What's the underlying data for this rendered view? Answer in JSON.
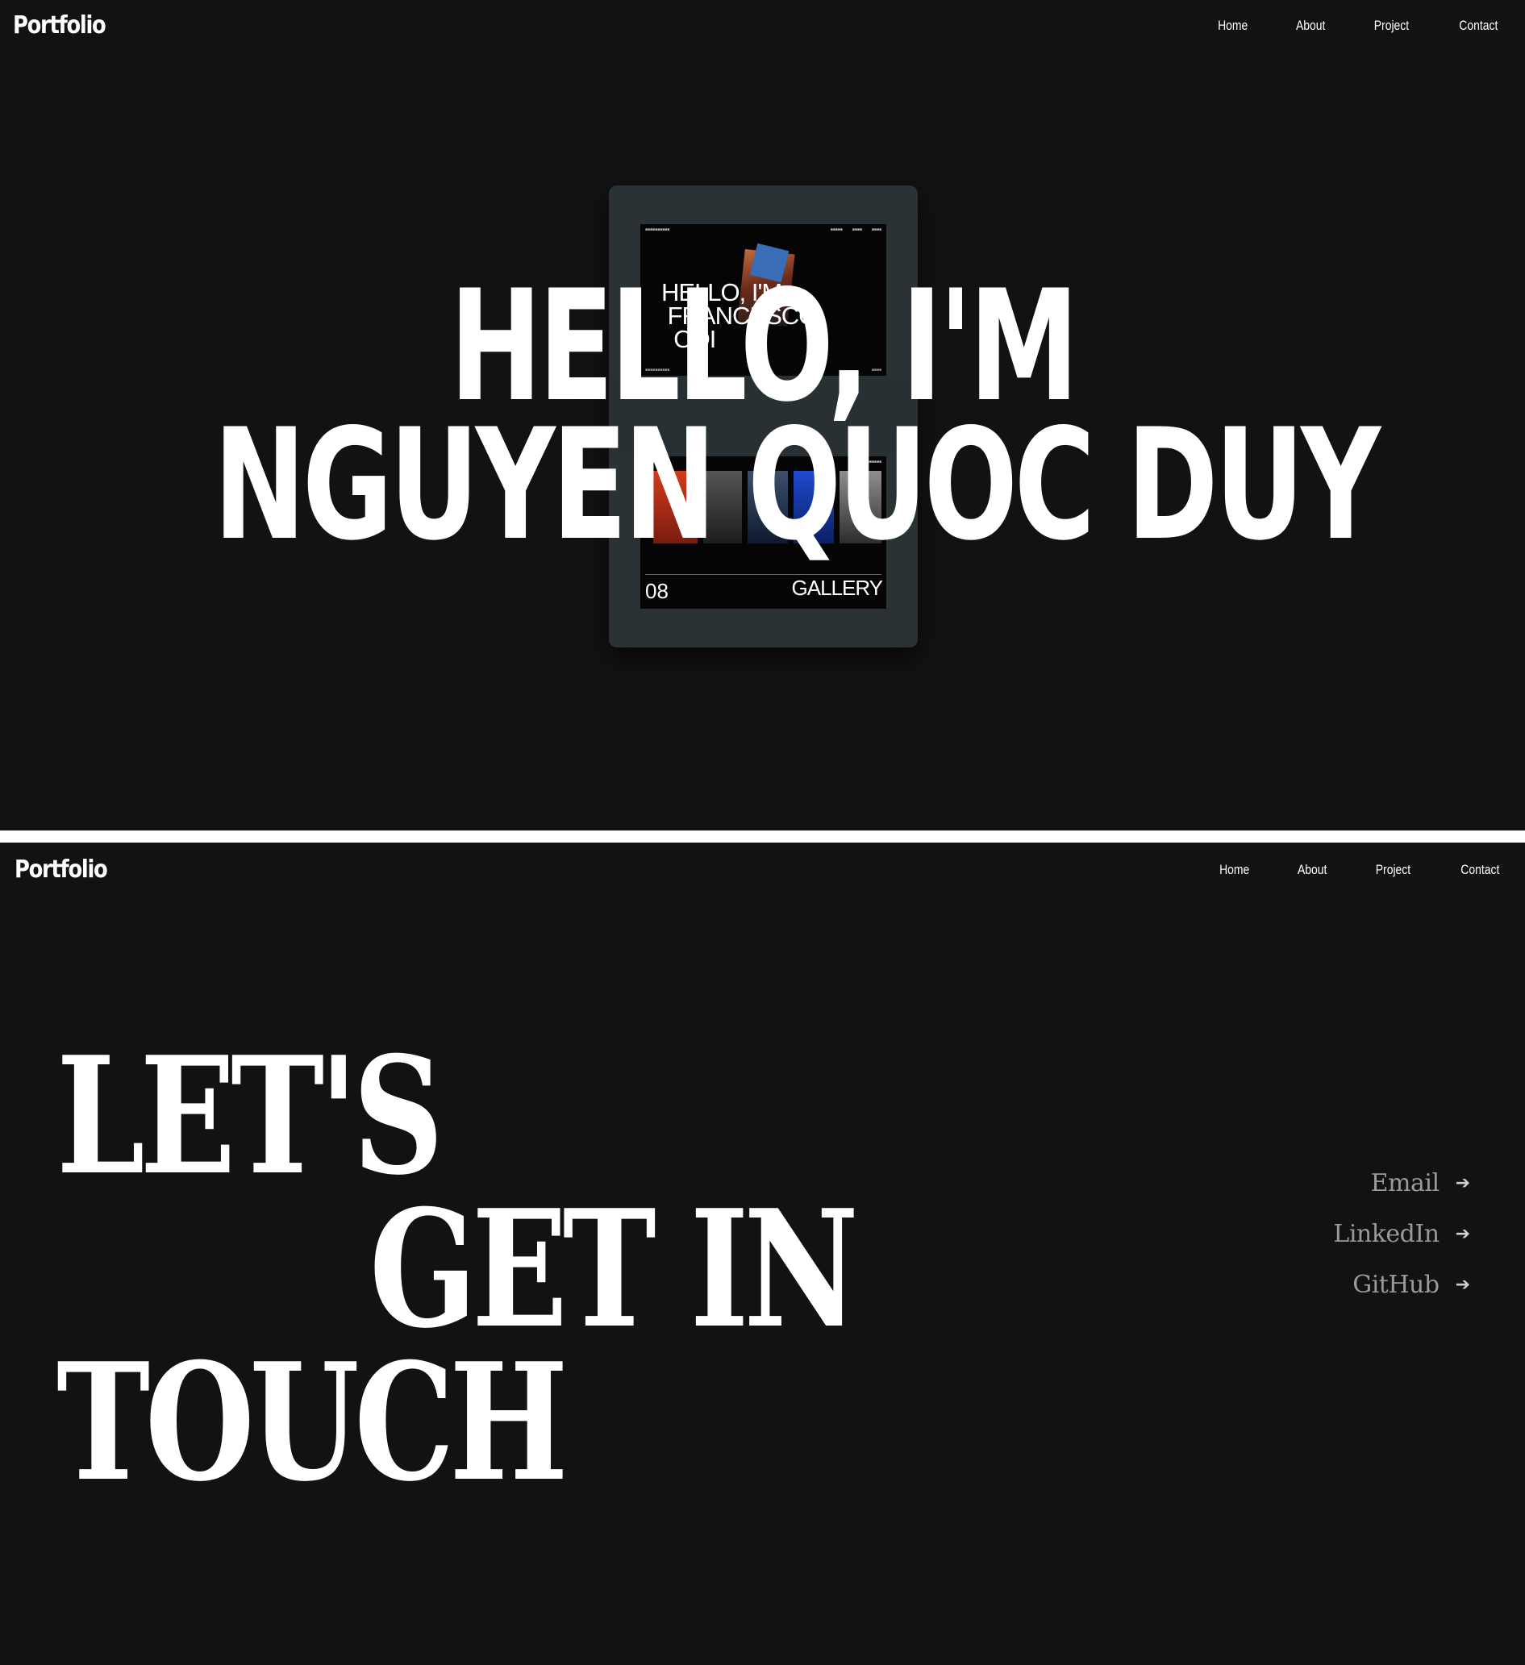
{
  "brand": "Portfolio",
  "nav": {
    "items": [
      {
        "label": "Home"
      },
      {
        "label": "About"
      },
      {
        "label": "Project"
      },
      {
        "label": "Contact"
      }
    ]
  },
  "hero": {
    "line1": "HELLO, I'M",
    "line2": "NGUYEN QUOC DUY",
    "mockup": {
      "headline": "HELLO, I'M\n FRANCESCO\n  ODI",
      "gallery_count": "08",
      "gallery_label": "GALLERY"
    }
  },
  "contact": {
    "line1": "LET'S",
    "line2": "GET IN",
    "line3": "TOUCH",
    "links": [
      {
        "label": "Email",
        "icon": "arrow-right-icon"
      },
      {
        "label": "LinkedIn",
        "icon": "arrow-right-icon"
      },
      {
        "label": "GitHub",
        "icon": "arrow-right-icon"
      }
    ]
  },
  "colors": {
    "background": "#121212",
    "text": "#ffffff",
    "muted_link": "#9a9a9a",
    "tablet_frame": "#2b3235"
  }
}
